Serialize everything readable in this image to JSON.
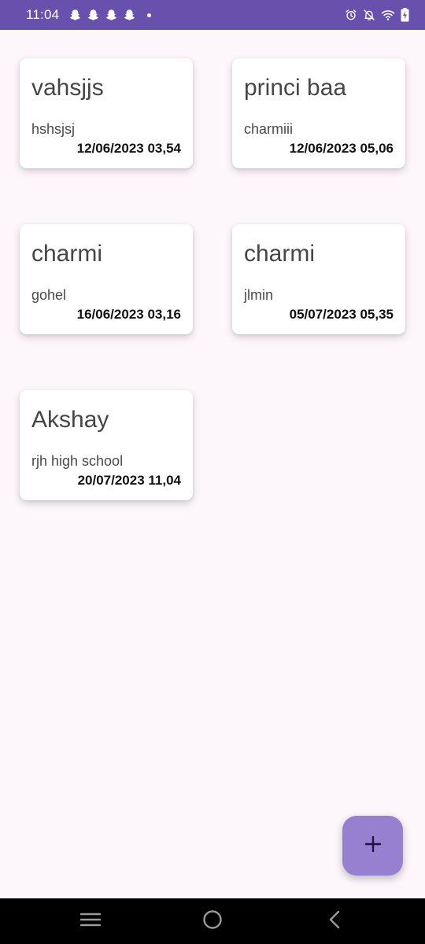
{
  "status_bar": {
    "time": "11:04",
    "notification_icons": [
      "snapchat-icon",
      "snapchat-icon",
      "snapchat-icon",
      "snapchat-icon",
      "more-notifications-dot"
    ],
    "system_icons": [
      "alarm-icon",
      "notifications-off-icon",
      "wifi-icon",
      "battery-charging-icon"
    ],
    "color": "#6751ad"
  },
  "notes": [
    {
      "title": "vahsjjs",
      "description": "hshsjsj",
      "date": "12/06/2023 03,54"
    },
    {
      "title": "princi baa",
      "description": "charmiii",
      "date": "12/06/2023 05,06"
    },
    {
      "title": "charmi",
      "description": "gohel",
      "date": "16/06/2023 03,16"
    },
    {
      "title": "charmi",
      "description": "jlmin",
      "date": "05/07/2023 05,35"
    },
    {
      "title": "Akshay",
      "description": "rjh high school",
      "date": "20/07/2023 11,04"
    }
  ],
  "fab": {
    "icon": "plus-icon",
    "color": "#9780cf"
  },
  "nav_bar": {
    "buttons": [
      "recents-icon",
      "home-icon",
      "back-icon"
    ]
  },
  "colors": {
    "background": "#fdf7fb",
    "card": "#ffffff"
  }
}
